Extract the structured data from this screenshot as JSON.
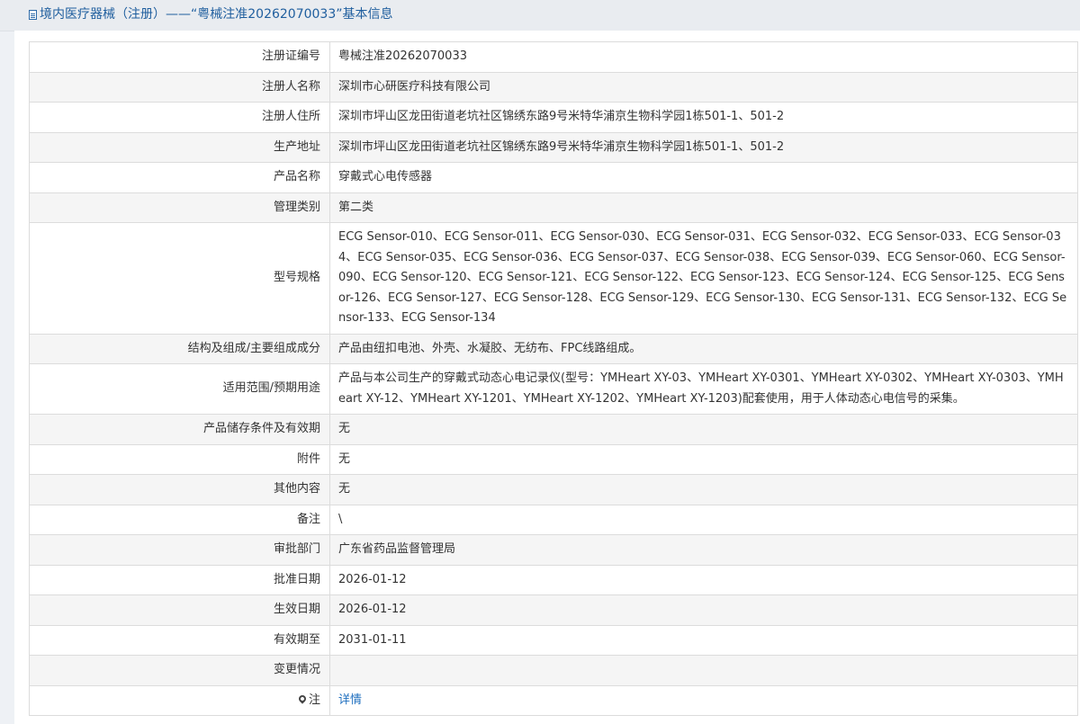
{
  "header": {
    "title": "境内医疗器械（注册）——“粤械注准20262070033”基本信息"
  },
  "rows": [
    {
      "label": "注册证编号",
      "value": "粤械注准20262070033"
    },
    {
      "label": "注册人名称",
      "value": "深圳市心研医疗科技有限公司"
    },
    {
      "label": "注册人住所",
      "value": "深圳市坪山区龙田街道老坑社区锦绣东路9号米特华浦京生物科学园1栋501-1、501-2"
    },
    {
      "label": "生产地址",
      "value": "深圳市坪山区龙田街道老坑社区锦绣东路9号米特华浦京生物科学园1栋501-1、501-2"
    },
    {
      "label": "产品名称",
      "value": "穿戴式心电传感器"
    },
    {
      "label": "管理类别",
      "value": "第二类"
    },
    {
      "label": "型号规格",
      "value": "ECG Sensor-010、ECG Sensor-011、ECG Sensor-030、ECG Sensor-031、ECG Sensor-032、ECG Sensor-033、ECG Sensor-034、ECG Sensor-035、ECG Sensor-036、ECG Sensor-037、ECG Sensor-038、ECG Sensor-039、ECG Sensor-060、ECG Sensor-090、ECG Sensor-120、ECG Sensor-121、ECG Sensor-122、ECG Sensor-123、ECG Sensor-124、ECG Sensor-125、ECG Sensor-126、ECG Sensor-127、ECG Sensor-128、ECG Sensor-129、ECG Sensor-130、ECG Sensor-131、ECG Sensor-132、ECG Sensor-133、ECG Sensor-134"
    },
    {
      "label": "结构及组成/主要组成成分",
      "value": "产品由纽扣电池、外壳、水凝胶、无纺布、FPC线路组成。"
    },
    {
      "label": "适用范围/预期用途",
      "value": "产品与本公司生产的穿戴式动态心电记录仪(型号：YMHeart XY-03、YMHeart XY-0301、YMHeart XY-0302、YMHeart XY-0303、YMHeart XY-12、YMHeart XY-1201、YMHeart XY-1202、YMHeart XY-1203)配套使用，用于人体动态心电信号的采集。"
    },
    {
      "label": "产品储存条件及有效期",
      "value": "无"
    },
    {
      "label": "附件",
      "value": "无"
    },
    {
      "label": "其他内容",
      "value": "无"
    },
    {
      "label": "备注",
      "value": "\\"
    },
    {
      "label": "审批部门",
      "value": "广东省药品监督管理局"
    },
    {
      "label": "批准日期",
      "value": "2026-01-12"
    },
    {
      "label": "生效日期",
      "value": "2026-01-12"
    },
    {
      "label": "有效期至",
      "value": "2031-01-11"
    },
    {
      "label": "变更情况",
      "value": ""
    }
  ],
  "note_row": {
    "label": "注",
    "link_text": "详情"
  }
}
